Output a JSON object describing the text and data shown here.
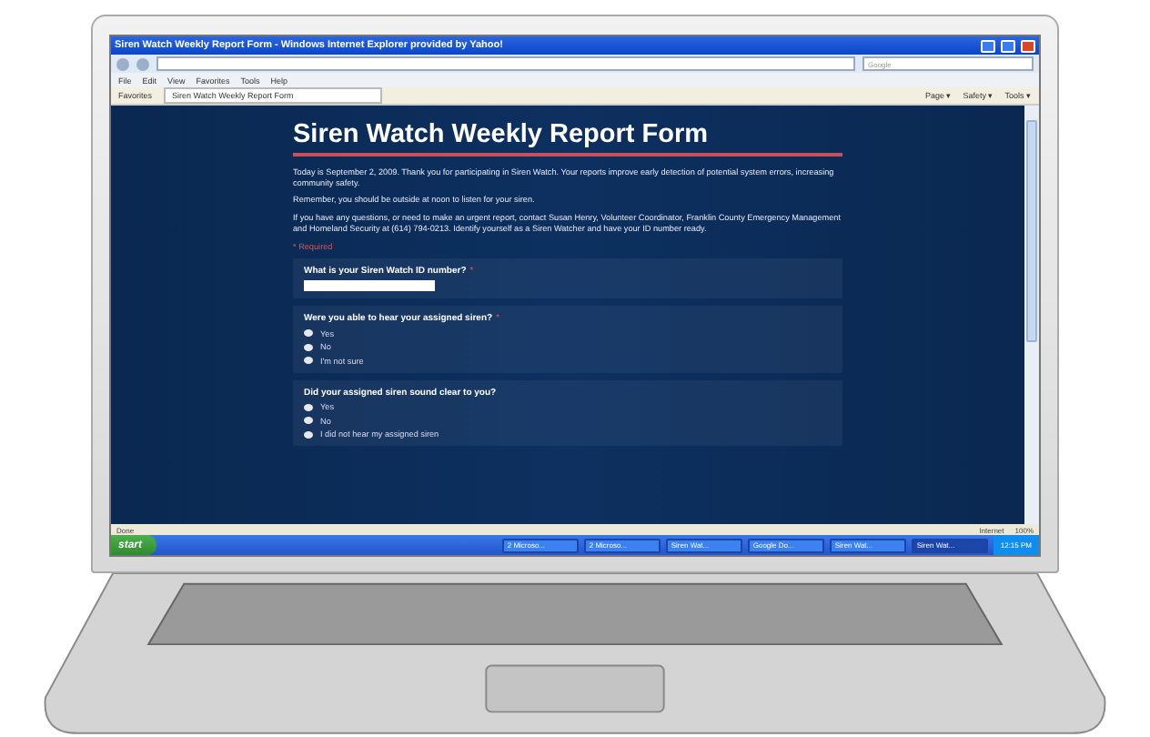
{
  "window": {
    "title": "Siren Watch Weekly Report Form - Windows Internet Explorer provided by Yahoo!"
  },
  "address_bar": {
    "search_placeholder": "Google"
  },
  "menu": [
    "File",
    "Edit",
    "View",
    "Favorites",
    "Tools",
    "Help"
  ],
  "favorites": {
    "label": "Favorites",
    "tab": "Siren Watch Weekly Report Form",
    "commands": [
      "Page ▾",
      "Safety ▾",
      "Tools ▾"
    ]
  },
  "form": {
    "title": "Siren Watch Weekly Report Form",
    "paragraphs": [
      "Today is September 2, 2009.  Thank you for participating in Siren Watch.  Your reports improve early detection of potential system errors, increasing community safety.",
      "Remember, you should be outside at noon to listen for your siren.",
      "If you have any questions, or need to make an urgent report, contact Susan Henry, Volunteer Coordinator, Franklin County Emergency Management and Homeland Security at (614) 794-0213.  Identify yourself as a Siren Watcher and have your ID number ready."
    ],
    "required_note": "* Required",
    "questions": [
      {
        "kind": "text",
        "label": "What is your Siren Watch ID number?",
        "required_mark": "*"
      },
      {
        "kind": "radio",
        "label": "Were you able to hear your assigned siren?",
        "required_mark": "*",
        "options": [
          {
            "label": "Yes",
            "selected": false
          },
          {
            "label": "No",
            "selected": false
          },
          {
            "label": "I'm not sure",
            "selected": false
          }
        ]
      },
      {
        "kind": "radio",
        "label": "Did your assigned siren sound clear to you?",
        "options": [
          {
            "label": "Yes",
            "selected": false
          },
          {
            "label": "No",
            "selected": false
          },
          {
            "label": "I did not hear my assigned siren",
            "selected": false
          }
        ]
      }
    ]
  },
  "status_bar": {
    "text": "Done",
    "zone": "Internet",
    "zoom": "100%"
  },
  "taskbar": {
    "start": "start",
    "items": [
      {
        "label": "2 Microso...",
        "selected": false
      },
      {
        "label": "2 Microso...",
        "selected": false
      },
      {
        "label": "Siren Wat...",
        "selected": false
      },
      {
        "label": "Google Do...",
        "selected": false
      },
      {
        "label": "Siren Wat...",
        "selected": false
      },
      {
        "label": "Siren Wat...",
        "selected": true
      }
    ],
    "clock": "12:15 PM"
  }
}
